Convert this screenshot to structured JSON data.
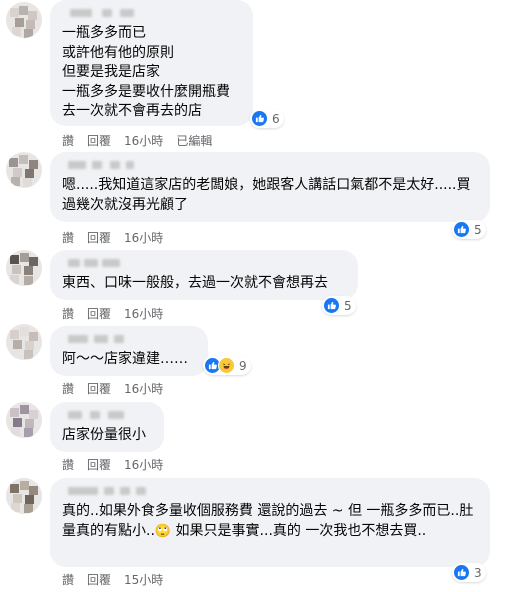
{
  "labels": {
    "like": "讚",
    "reply": "回覆",
    "edited": "已編輯"
  },
  "comments": [
    {
      "text": "一瓶多多而已\n或許他有他的原則\n但要是我是店家\n一瓶多多是要收什麼開瓶費\n去一次就不會再去的店",
      "time": "16小時",
      "edited": true,
      "reactions": [
        "like"
      ],
      "reaction_count": "6"
    },
    {
      "text": "嗯.....我知道這家店的老闆娘，她跟客人講話口氣都不是太好.....買過幾次就沒再光顧了",
      "time": "16小時",
      "reactions": [
        "like"
      ],
      "reaction_count": "5"
    },
    {
      "text": "東西、口味一般般，去過一次就不會想再去",
      "time": "16小時",
      "reactions": [
        "like"
      ],
      "reaction_count": "5"
    },
    {
      "text": "阿～～店家違建……",
      "time": "16小時",
      "reactions": [
        "like",
        "haha"
      ],
      "reaction_count": "9"
    },
    {
      "text": "店家份量很小",
      "time": "16小時",
      "reactions": [],
      "reaction_count": ""
    },
    {
      "text_part1": "真的..如果外食多量收個服務費 還說的過去 ~ 但 一瓶多多而已..肚量真的有點小..",
      "emoji": "🙄",
      "text_part2": " 如果只是事實...真的 一次我也不想去買..",
      "time": "15小時",
      "reactions": [
        "like"
      ],
      "reaction_count": "3"
    }
  ],
  "colors": {
    "bubble": "#f0f2f5",
    "meta": "#65676b",
    "like": "#1877f2",
    "haha": "#f7c837"
  },
  "icons": [
    "like-icon",
    "haha-icon"
  ]
}
